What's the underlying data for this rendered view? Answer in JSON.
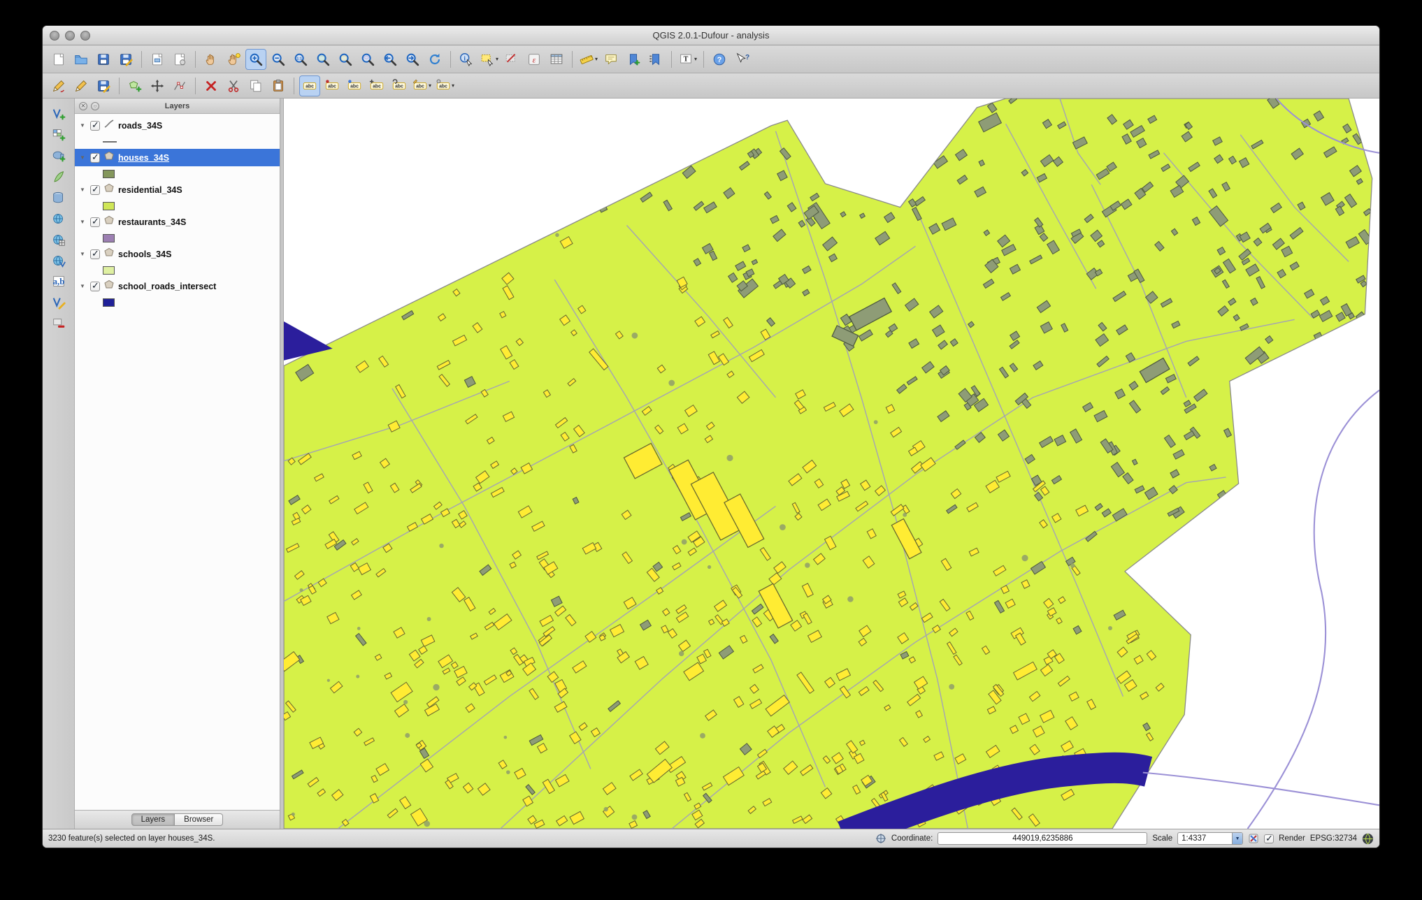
{
  "window": {
    "title": "QGIS 2.0.1-Dufour - analysis"
  },
  "toolbars": {
    "main": {
      "groups": [
        [
          "new-project-icon",
          "open-project-icon",
          "save-project-icon",
          "save-project-as-icon"
        ],
        [
          "new-composer-icon",
          "composer-manager-icon"
        ],
        [
          "pan-map-icon",
          "pan-to-selection-icon",
          "zoom-in-icon",
          "zoom-out-icon",
          "zoom-actual-icon",
          "zoom-full-icon",
          "zoom-to-selection-icon",
          "zoom-to-layer-icon",
          "zoom-last-icon",
          "zoom-next-icon",
          "refresh-map-icon"
        ],
        [
          "identify-features-icon",
          "select-features-icon",
          "deselect-features-icon",
          "field-calculator-icon",
          "open-attribute-table-icon"
        ],
        [
          "measure-icon",
          "map-tips-icon",
          "new-bookmark-icon",
          "show-bookmarks-icon"
        ],
        [
          "text-annotation-icon"
        ],
        [
          "help-contents-icon",
          "whats-this-icon"
        ]
      ]
    },
    "digitizing": {
      "groups": [
        [
          "current-edits-icon",
          "toggle-editing-icon",
          "save-layer-edits-icon"
        ],
        [
          "add-feature-icon",
          "move-feature-icon",
          "node-tool-icon"
        ],
        [
          "delete-selected-icon",
          "cut-features-icon",
          "copy-features-icon",
          "paste-features-icon"
        ],
        [
          "layer-labeling-icon",
          "label-pin-icon",
          "label-show-hide-icon",
          "label-move-icon",
          "label-rotate-icon",
          "label-change-icon",
          "label-properties-icon"
        ]
      ]
    },
    "manage_layers": {
      "groups": [
        [
          "add-vector-layer-icon",
          "add-raster-layer-icon",
          "add-postgis-layer-icon",
          "add-spatialite-layer-icon",
          "add-mssql-layer-icon",
          "add-wms-layer-icon",
          "add-wcs-layer-icon",
          "add-wfs-layer-icon",
          "add-delimited-text-icon",
          "new-shapefile-layer-icon",
          "remove-layer-icon"
        ]
      ]
    }
  },
  "layers_panel": {
    "title": "Layers",
    "layers": [
      {
        "label": "roads_34S",
        "checked": true,
        "selected": false,
        "symbol_type": "line",
        "symbol_color": "#6e6e6e"
      },
      {
        "label": "houses_34S",
        "checked": true,
        "selected": true,
        "symbol_type": "fill",
        "symbol_color": "#84975c"
      },
      {
        "label": "residential_34S",
        "checked": true,
        "selected": false,
        "symbol_type": "fill",
        "symbol_color": "#cfe657"
      },
      {
        "label": "restaurants_34S",
        "checked": true,
        "selected": false,
        "symbol_type": "fill",
        "symbol_color": "#9c7fb2"
      },
      {
        "label": "schools_34S",
        "checked": true,
        "selected": false,
        "symbol_type": "fill",
        "symbol_color": "#dff0a2"
      },
      {
        "label": "school_roads_intersect",
        "checked": true,
        "selected": false,
        "symbol_type": "fill",
        "symbol_color": "#1f2098"
      }
    ],
    "tabs": [
      {
        "label": "Layers",
        "active": true
      },
      {
        "label": "Browser",
        "active": false
      }
    ]
  },
  "map": {
    "colors": {
      "background": "#ffffff",
      "land": "#d6f148",
      "land_border": "#8a8a8a",
      "water": "#2b1e9c",
      "stream": "#9b90d6",
      "road": "#a4a4b4",
      "house_selected_fill": "#ffec33",
      "house_selected_stroke": "#6a6a2e",
      "house_fill": "#8e9c76",
      "house_stroke": "#4e5a40",
      "tree": "#94a268"
    }
  },
  "statusbar": {
    "message": "3230 feature(s) selected on layer houses_34S.",
    "coordinate_label": "Coordinate:",
    "coordinate_value": "449019,6235886",
    "scale_label": "Scale",
    "scale_value": "1:4337",
    "render_label": "Render",
    "epsg_label": "EPSG:32734",
    "icons": [
      "mouse-position-icon",
      "stop-rendering-icon",
      "crs-status-icon"
    ]
  }
}
